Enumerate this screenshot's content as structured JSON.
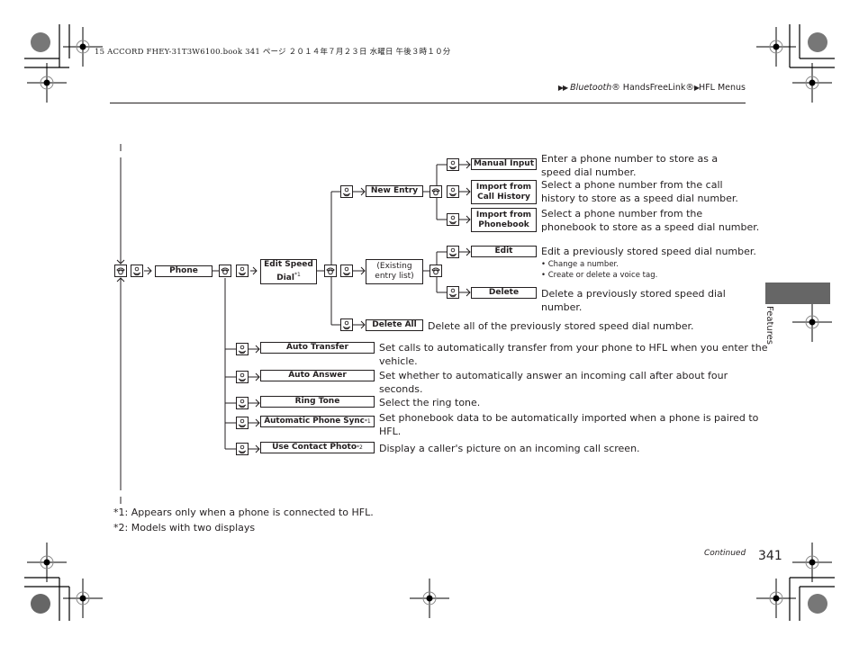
{
  "print_header": "15 ACCORD FHEY-31T3W6100.book  341 ページ  ２０１４年７月２３日  水曜日  午後３時１０分",
  "breadcrumb": {
    "arrows": "▶▶",
    "part1": "Bluetooth",
    "part1_suffix": "® HandsFreeLink®",
    "sep": "▶",
    "part2": "HFL Menus"
  },
  "icons": {
    "phone": "phone-icon",
    "voice": "voice-command-icon"
  },
  "tree": {
    "phone": "Phone",
    "edit_speed_dial": {
      "line1": "Edit Speed",
      "line2": "Dial",
      "note": "*1"
    },
    "new_entry": "New Entry",
    "manual_input": "Manual Input",
    "import_call_history": {
      "line1": "Import from",
      "line2": "Call History"
    },
    "import_phonebook": {
      "line1": "Import from",
      "line2": "Phonebook"
    },
    "existing_entry_list": {
      "line1": "(Existing",
      "line2": "entry list)"
    },
    "edit": "Edit",
    "delete": "Delete",
    "delete_all": "Delete All",
    "auto_transfer": "Auto Transfer",
    "auto_answer": "Auto Answer",
    "ring_tone": "Ring Tone",
    "auto_phone_sync": {
      "label": "Automatic Phone Sync",
      "note": "*1"
    },
    "use_contact_photo": {
      "label": "Use Contact Photo",
      "note": "*2"
    }
  },
  "descriptions": {
    "manual_input": [
      "Enter a phone number to store as a",
      "speed dial number."
    ],
    "import_call_history": [
      "Select a phone number from the call",
      "history to store as a speed dial number."
    ],
    "import_phonebook": [
      "Select a phone number from the",
      "phonebook to store as a speed dial number."
    ],
    "edit": "Edit a previously stored speed dial number.",
    "edit_bullets": [
      "Change a number.",
      "Create or delete a voice tag."
    ],
    "delete": [
      "Delete a previously stored speed dial",
      "number."
    ],
    "delete_all": "Delete all of the previously stored speed dial number.",
    "auto_transfer": [
      "Set calls to automatically transfer from your phone to HFL when you enter the",
      "vehicle."
    ],
    "auto_answer": [
      "Set whether to automatically answer an incoming call after about four",
      "seconds."
    ],
    "ring_tone": "Select the ring tone.",
    "auto_phone_sync": [
      "Set phonebook data to be automatically imported when a phone is paired to",
      "HFL."
    ],
    "use_contact_photo": "Display a caller's picture on an incoming call screen."
  },
  "footnotes": [
    "*1: Appears only when a phone is connected to HFL.",
    "*2: Models with two displays"
  ],
  "side_tab": {
    "label": "Features",
    "color": "#666666"
  },
  "footer": {
    "continued": "Continued",
    "page_number": "341"
  }
}
